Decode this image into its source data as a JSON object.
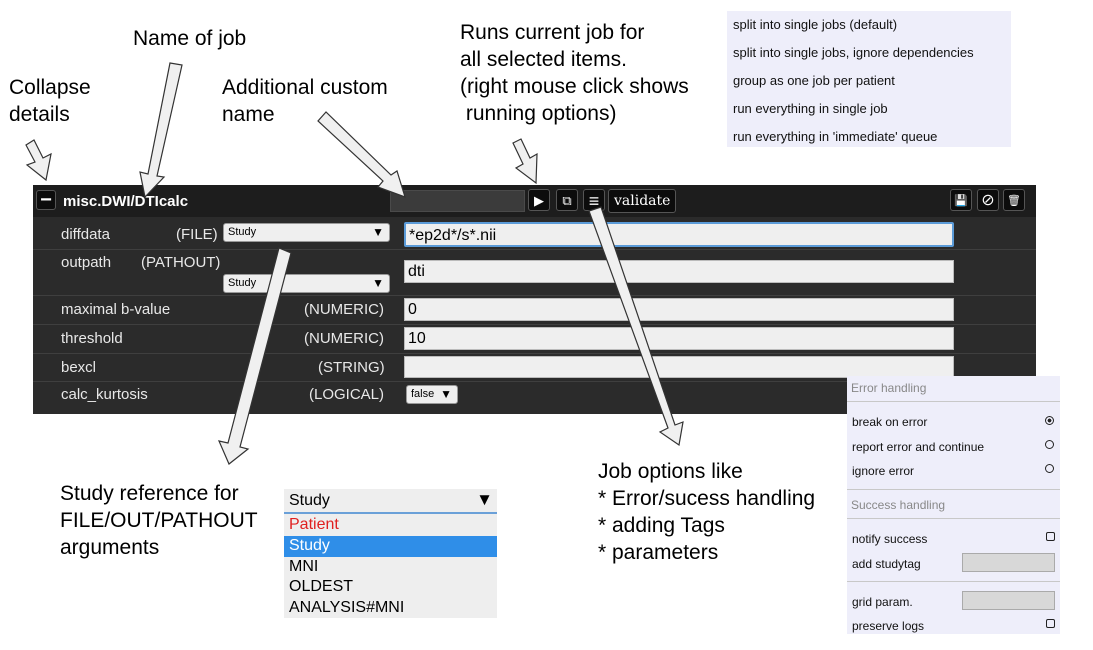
{
  "annotations": {
    "collapse": [
      "Collapse",
      "details"
    ],
    "name_of_job": "Name of job",
    "custom_name": [
      "Additional custom",
      "name"
    ],
    "runs": [
      "Runs current job for",
      "all selected items.",
      "(right mouse click shows",
      " running options)"
    ],
    "study_ref": [
      "Study reference for",
      "FILE/OUT/PATHOUT",
      "arguments"
    ],
    "job_options": [
      "Job options like",
      "* Error/sucess handling",
      "* adding Tags",
      "* parameters"
    ]
  },
  "job": {
    "collapse_glyph": "−",
    "title": "misc.DWI/DTIcalc",
    "custom_name_value": "",
    "buttons": {
      "run_glyph": "▶",
      "copy_glyph": "⧉",
      "menu_glyph": "≡",
      "validate_label": "validate",
      "save_glyph": "💾",
      "disable_glyph": "⊘",
      "delete_glyph": "🗑"
    },
    "params": [
      {
        "name": "diffdata",
        "type": "(FILE)",
        "select": "Study",
        "value": "*ep2d*/s*.nii"
      },
      {
        "name": "outpath",
        "type": "(PATHOUT)",
        "select": "Study",
        "value": "dti"
      },
      {
        "name": "maximal b-value",
        "type": "(NUMERIC)",
        "value": "0"
      },
      {
        "name": "threshold",
        "type": "(NUMERIC)",
        "value": "10"
      },
      {
        "name": "bexcl",
        "type": "(STRING)",
        "value": ""
      },
      {
        "name": "calc_kurtosis",
        "type": "(LOGICAL)",
        "select": "false"
      }
    ],
    "caret": "▼"
  },
  "split_menu": [
    "split into single jobs (default)",
    "split into single jobs, ignore dependencies",
    "group as one job per patient",
    "run everything in single job",
    "run everything in 'immediate' queue"
  ],
  "study_list": {
    "selected": "Study",
    "caret": "▼",
    "options": [
      "Patient",
      "Study",
      "MNI",
      "OLDEST",
      "ANALYSIS#MNI"
    ]
  },
  "options_menu": {
    "error_section": "Error handling",
    "break_on_error": "break on error",
    "report_error": "report error and continue",
    "ignore_error": "ignore error",
    "success_section": "Success handling",
    "notify_success": "notify success",
    "add_studytag": "add studytag",
    "grid_param": "grid param.",
    "preserve_logs": "preserve logs"
  },
  "colors": {
    "panel_bg": "#2b2b2b",
    "header_bg": "#1d1d1d",
    "patient_text": "#e02020",
    "selected_bg": "#2f8ee8",
    "menu_bg": "#eeeefa"
  }
}
